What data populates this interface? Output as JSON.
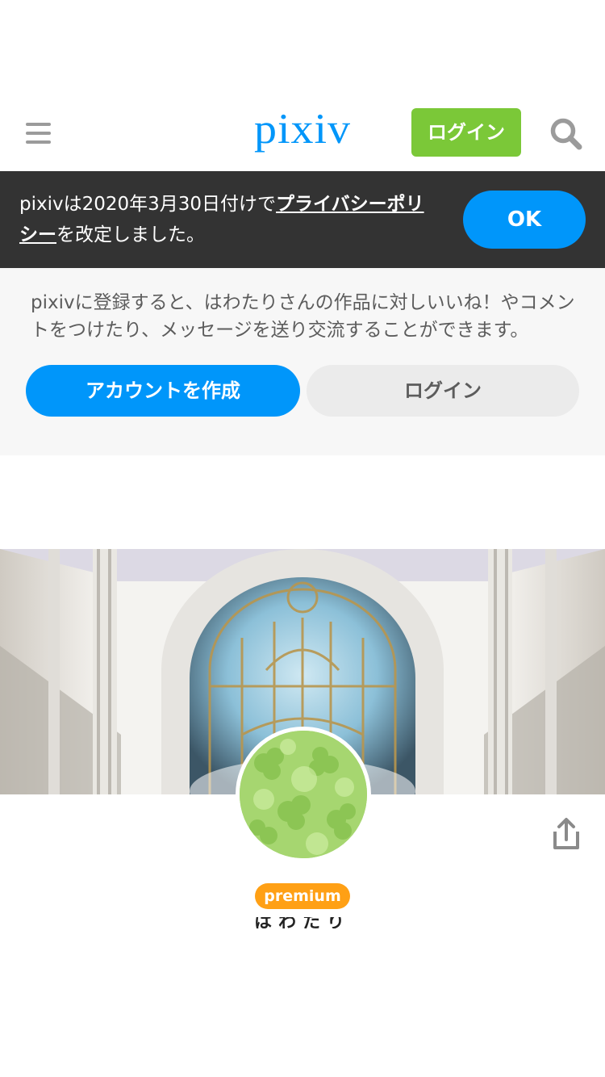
{
  "header": {
    "logo_text": "pixiv",
    "login_label": "ログイン"
  },
  "notice": {
    "text_before": "pixivは2020年3月30日付けで",
    "link_text": "プライバシーポリシー",
    "text_after": "を改定しました。",
    "ok_label": "OK"
  },
  "register": {
    "message": "pixivに登録すると、はわたりさんの作品に対しいいね！やコメントをつけたり、メッセージを送り交流することができます。",
    "create_label": "アカウントを作成",
    "login_label": "ログイン"
  },
  "profile": {
    "badge": "premium",
    "username": "はわたり"
  },
  "colors": {
    "brand_blue": "#0096fa",
    "login_green": "#7bc838",
    "premium_orange": "#ffa015",
    "notice_bg": "#333333"
  },
  "icons": {
    "menu": "hamburger-icon",
    "search": "search-icon",
    "share": "share-icon"
  }
}
